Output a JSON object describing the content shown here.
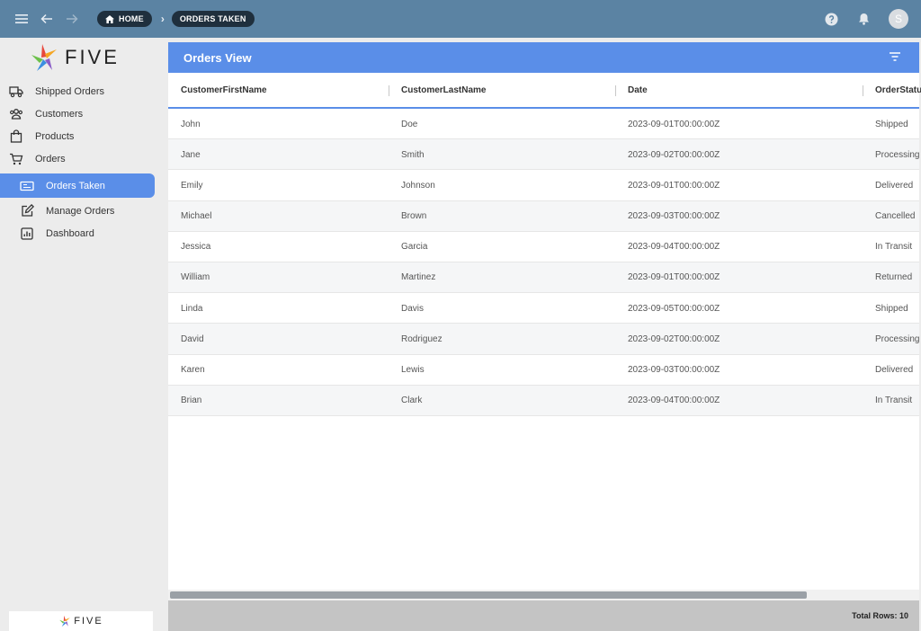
{
  "topbar": {
    "breadcrumbs": [
      {
        "label": "HOME"
      },
      {
        "label": "ORDERS TAKEN"
      }
    ],
    "avatar_initial": "S"
  },
  "sidebar": {
    "logo_text": "FIVE",
    "items": [
      {
        "label": "Shipped Orders",
        "icon": "truck-icon"
      },
      {
        "label": "Customers",
        "icon": "people-icon"
      },
      {
        "label": "Products",
        "icon": "bag-icon"
      },
      {
        "label": "Orders",
        "icon": "cart-icon"
      },
      {
        "label": "Orders Taken",
        "icon": "ticket-icon",
        "active": true
      },
      {
        "label": "Manage Orders",
        "icon": "edit-icon"
      },
      {
        "label": "Dashboard",
        "icon": "chart-icon"
      }
    ],
    "footer_logo_text": "FIVE"
  },
  "main": {
    "title": "Orders View",
    "columns": [
      "CustomerFirstName",
      "CustomerLastName",
      "Date",
      "OrderStatus"
    ],
    "rows": [
      [
        "John",
        "Doe",
        "2023-09-01T00:00:00Z",
        "Shipped"
      ],
      [
        "Jane",
        "Smith",
        "2023-09-02T00:00:00Z",
        "Processing"
      ],
      [
        "Emily",
        "Johnson",
        "2023-09-01T00:00:00Z",
        "Delivered"
      ],
      [
        "Michael",
        "Brown",
        "2023-09-03T00:00:00Z",
        "Cancelled"
      ],
      [
        "Jessica",
        "Garcia",
        "2023-09-04T00:00:00Z",
        "In Transit"
      ],
      [
        "William",
        "Martinez",
        "2023-09-01T00:00:00Z",
        "Returned"
      ],
      [
        "Linda",
        "Davis",
        "2023-09-05T00:00:00Z",
        "Shipped"
      ],
      [
        "David",
        "Rodriguez",
        "2023-09-02T00:00:00Z",
        "Processing"
      ],
      [
        "Karen",
        "Lewis",
        "2023-09-03T00:00:00Z",
        "Delivered"
      ],
      [
        "Brian",
        "Clark",
        "2023-09-04T00:00:00Z",
        "In Transit"
      ]
    ],
    "footer_text": "Total Rows: 10"
  },
  "colors": {
    "topbar": "#5b83a3",
    "accent": "#5a8ee8",
    "breadcrumb_pill": "#1f2f3d"
  }
}
